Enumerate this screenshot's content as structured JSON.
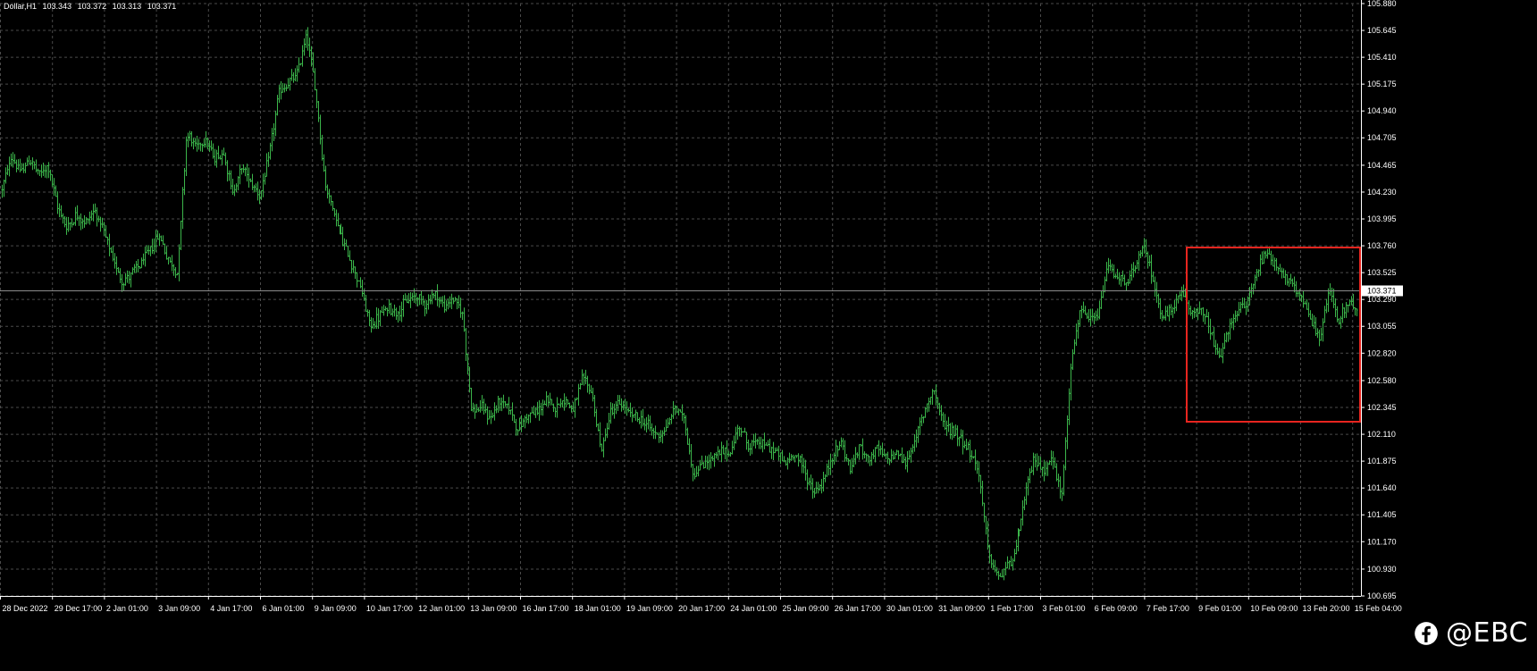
{
  "header": {
    "symbol": "Dollar,H1",
    "ohlc": [
      "103.343",
      "103.372",
      "103.313",
      "103.371"
    ]
  },
  "watermark": {
    "icon": "facebook-icon",
    "handle": "@EBC"
  },
  "colors": {
    "background": "#000000",
    "grid": "#4a4a4a",
    "bars": "#3bb54a",
    "axis_text": "#ffffff",
    "highlight_box": "#e8251f",
    "current_price_line": "#8c8c8c"
  },
  "chart_data": {
    "type": "line",
    "style": "ohlc-bars",
    "timeframe": "H1",
    "current_price": 103.371,
    "ylim": [
      100.695,
      105.88
    ],
    "y_ticks": [
      "105.880",
      "105.645",
      "105.410",
      "105.175",
      "104.940",
      "104.705",
      "104.465",
      "104.230",
      "103.995",
      "103.760",
      "103.525",
      "103.290",
      "103.055",
      "102.820",
      "102.580",
      "102.345",
      "102.110",
      "101.875",
      "101.640",
      "101.405",
      "101.170",
      "100.930",
      "100.695"
    ],
    "x_ticks": [
      "28 Dec 2022",
      "29 Dec 17:00",
      "2 Jan 01:00",
      "3 Jan 09:00",
      "4 Jan 17:00",
      "6 Jan 01:00",
      "9 Jan 09:00",
      "10 Jan 17:00",
      "12 Jan 01:00",
      "13 Jan 09:00",
      "16 Jan 17:00",
      "18 Jan 01:00",
      "19 Jan 09:00",
      "20 Jan 17:00",
      "24 Jan 01:00",
      "25 Jan 09:00",
      "26 Jan 17:00",
      "30 Jan 01:00",
      "31 Jan 09:00",
      "1 Feb 17:00",
      "3 Feb 01:00",
      "6 Feb 09:00",
      "7 Feb 17:00",
      "9 Feb 01:00",
      "10 Feb 09:00",
      "13 Feb 20:00",
      "15 Feb 04:00"
    ],
    "grid": true,
    "series": [
      {
        "values": [
          104.25,
          104.55,
          104.4,
          104.52,
          104.38,
          104.46,
          104.1,
          103.92,
          104.03,
          103.96,
          104.08,
          103.88,
          103.64,
          103.45,
          103.51,
          103.6,
          103.72,
          103.86,
          103.64,
          103.52,
          104.75,
          104.62,
          104.7,
          104.52,
          104.58,
          104.22,
          104.45,
          104.31,
          104.2,
          104.58,
          105.1,
          105.18,
          105.27,
          105.62,
          105.1,
          104.3,
          104.05,
          103.8,
          103.6,
          103.38,
          103.05,
          103.15,
          103.22,
          103.18,
          103.28,
          103.32,
          103.25,
          103.35,
          103.22,
          103.3,
          103.16,
          102.3,
          102.35,
          102.25,
          102.4,
          102.35,
          102.15,
          102.28,
          102.3,
          102.4,
          102.35,
          102.42,
          102.32,
          102.6,
          102.48,
          101.95,
          102.3,
          102.38,
          102.3,
          102.25,
          102.2,
          102.1,
          102.15,
          102.35,
          102.25,
          101.75,
          101.85,
          101.9,
          101.95,
          101.95,
          102.2,
          102.0,
          102.05,
          102.0,
          101.95,
          101.85,
          101.95,
          101.8,
          101.6,
          101.68,
          101.9,
          102.05,
          101.8,
          102.0,
          101.9,
          101.98,
          101.88,
          101.96,
          101.85,
          102.05,
          102.3,
          102.52,
          102.2,
          102.15,
          102.08,
          101.95,
          101.75,
          101.05,
          100.85,
          100.95,
          101.1,
          101.55,
          101.9,
          101.8,
          101.9,
          101.55,
          102.7,
          103.2,
          103.1,
          103.15,
          103.6,
          103.5,
          103.4,
          103.6,
          103.75,
          103.42,
          103.12,
          103.2,
          103.35,
          103.18,
          103.22,
          103.05,
          102.75,
          103.0,
          103.18,
          103.25,
          103.48,
          103.72,
          103.62,
          103.52,
          103.4,
          103.3,
          103.12,
          102.95,
          103.38,
          103.1,
          103.25,
          103.2
        ]
      }
    ]
  }
}
